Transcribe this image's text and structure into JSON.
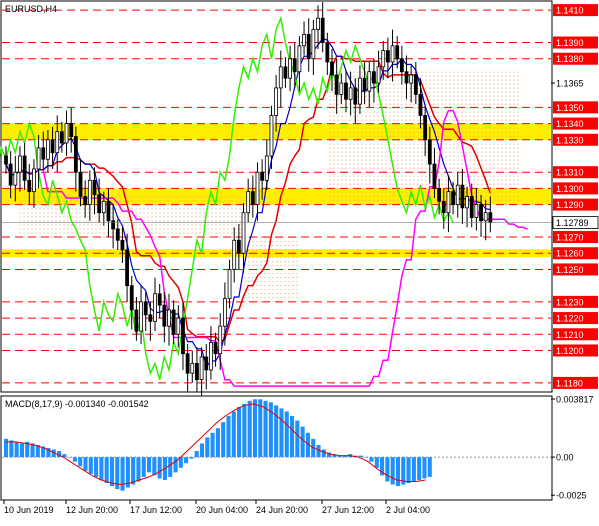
{
  "window": {
    "symbol_label": "EURUSD,H4",
    "macd_label": "MACD(8,17,9) -0.001340 -0.001542"
  },
  "colors": {
    "background": "#ffffff",
    "axis": "#000000",
    "candle_up": "#000000",
    "candle_down": "#000000",
    "resistance_line": "#ff0000",
    "highlight_band": "#ffee00",
    "price_label_bg": "#ff0000",
    "current_price_label_bg": "#ffffff",
    "kijun": "#e00000",
    "tenkan": "#0000c8",
    "chikou": "#33ee00",
    "senkou": "#ff00ff",
    "cloud_dots": "#e8a070",
    "bollinger": "#00cc66",
    "macd_hist": "#1e90ff",
    "macd_signal": "#e00000"
  },
  "chart_data": [
    {
      "type": "candlestick",
      "title": "EURUSD,H4",
      "ylim": [
        1.1175,
        1.1415
      ],
      "y_ticks": [
        "1.1410",
        "1.1390",
        "1.1380",
        "1.1365",
        "1.1350",
        "1.1340",
        "1.1330",
        "1.1310",
        "1.1300",
        "1.1290",
        "1.1278",
        "1.1270",
        "1.1260",
        "1.1250",
        "1.1230",
        "1.1220",
        "1.1210",
        "1.1200",
        "1.1180"
      ],
      "current_price": "1.12789",
      "current_price_value": 1.12789,
      "resistance_levels": [
        1.141,
        1.139,
        1.138,
        1.135,
        1.134,
        1.133,
        1.131,
        1.13,
        1.129,
        1.127,
        1.126,
        1.125,
        1.123,
        1.122,
        1.121,
        1.12,
        1.118
      ],
      "level_labels": [
        "1.1410",
        "1.1390",
        "1.1380",
        "1.1350",
        "1.1340",
        "1.1330",
        "1.1310",
        "1.1300",
        "1.1290",
        "1.1270",
        "1.1260",
        "1.1250",
        "1.1230",
        "1.1220",
        "1.1210",
        "1.1200",
        "1.1180"
      ],
      "highlight_zones": [
        [
          1.133,
          1.134
        ],
        [
          1.129,
          1.13
        ],
        [
          1.126,
          1.126
        ]
      ],
      "x_labels": [
        "10 Jun 2019",
        "12 Jun 20:00",
        "17 Jun 12:00",
        "20 Jun 04:00",
        "24 Jun 20:00",
        "27 Jun 12:00",
        "2 Jul 04:00"
      ],
      "closes": [
        1.1315,
        1.1302,
        1.131,
        1.132,
        1.1305,
        1.1298,
        1.1312,
        1.1325,
        1.1318,
        1.133,
        1.1322,
        1.1335,
        1.1328,
        1.134,
        1.1332,
        1.131,
        1.1295,
        1.129,
        1.1305,
        1.1296,
        1.1285,
        1.1292,
        1.128,
        1.1275,
        1.1268,
        1.1262,
        1.124,
        1.1225,
        1.1212,
        1.123,
        1.1222,
        1.1218,
        1.1235,
        1.1228,
        1.1215,
        1.1225,
        1.121,
        1.122,
        1.1198,
        1.1186,
        1.1192,
        1.1182,
        1.1196,
        1.1188,
        1.1205,
        1.1198,
        1.1215,
        1.1232,
        1.125,
        1.1268,
        1.126,
        1.1285,
        1.1298,
        1.129,
        1.131,
        1.1305,
        1.132,
        1.1345,
        1.1362,
        1.1375,
        1.1368,
        1.138,
        1.1372,
        1.1388,
        1.1395,
        1.138,
        1.1398,
        1.1405,
        1.139,
        1.1378,
        1.137,
        1.1358,
        1.1365,
        1.1355,
        1.1362,
        1.1352,
        1.1368,
        1.136,
        1.1372,
        1.1365,
        1.1375,
        1.1385,
        1.1378,
        1.1388,
        1.138,
        1.1372,
        1.1365,
        1.137,
        1.1358,
        1.1345,
        1.133,
        1.1315,
        1.13,
        1.1292,
        1.1285,
        1.1298,
        1.129,
        1.1302,
        1.1288,
        1.1295,
        1.1282,
        1.129,
        1.128,
        1.1285,
        1.12789
      ]
    },
    {
      "type": "bar",
      "title": "MACD(8,17,9)",
      "ylim": [
        -0.00275,
        0.00395
      ],
      "y_ticks": [
        "0.003817",
        "0.00",
        "-0.0025"
      ],
      "y_tick_values": [
        0.003817,
        0,
        -0.0025
      ],
      "macd_value": "-0.001340",
      "signal_value": "-0.001542",
      "histogram": [
        0.0012,
        0.0011,
        0.001,
        0.0009,
        0.001,
        0.0009,
        0.0008,
        0.0007,
        0.0006,
        0.0005,
        0.0004,
        0.0002,
        0.0,
        -0.0003,
        -0.0006,
        -0.0009,
        -0.0011,
        -0.0013,
        -0.0015,
        -0.0017,
        -0.0019,
        -0.0021,
        -0.0022,
        -0.002,
        -0.0018,
        -0.0016,
        -0.0013,
        -0.001,
        -0.0012,
        -0.0014,
        -0.0015,
        -0.0013,
        -0.001,
        -0.0007,
        -0.0004,
        -0.0001,
        0.0004,
        0.0009,
        0.0013,
        0.0016,
        0.0019,
        0.0023,
        0.0027,
        0.003,
        0.0033,
        0.0035,
        0.0037,
        0.0038,
        0.0038,
        0.0037,
        0.0036,
        0.0034,
        0.0032,
        0.003,
        0.0027,
        0.0024,
        0.002,
        0.0016,
        0.0012,
        0.0008,
        0.0005,
        0.0003,
        0.0002,
        0.0001,
        0.0001,
        0.0002,
        0.0001,
        0.0001,
        0.0,
        -0.0003,
        -0.0007,
        -0.0012,
        -0.0016,
        -0.0018,
        -0.0019,
        -0.0018,
        -0.0017,
        -0.0016,
        -0.0015,
        -0.0014,
        -0.0013
      ],
      "signal": [
        0.001,
        0.001,
        0.0009,
        0.0008,
        0.0006,
        0.0003,
        0.0,
        -0.0004,
        -0.0008,
        -0.0012,
        -0.0015,
        -0.0017,
        -0.0018,
        -0.0017,
        -0.0015,
        -0.0013,
        -0.001,
        -0.0006,
        -0.0002,
        0.0004,
        0.001,
        0.0016,
        0.0022,
        0.0027,
        0.0031,
        0.0034,
        0.0035,
        0.0033,
        0.0029,
        0.0024,
        0.0018,
        0.0012,
        0.0007,
        0.0004,
        0.0002,
        0.0001,
        0.0001,
        0.0,
        -0.0003,
        -0.0008,
        -0.0012,
        -0.0015,
        -0.0016,
        -0.0016,
        -0.0015
      ]
    }
  ]
}
